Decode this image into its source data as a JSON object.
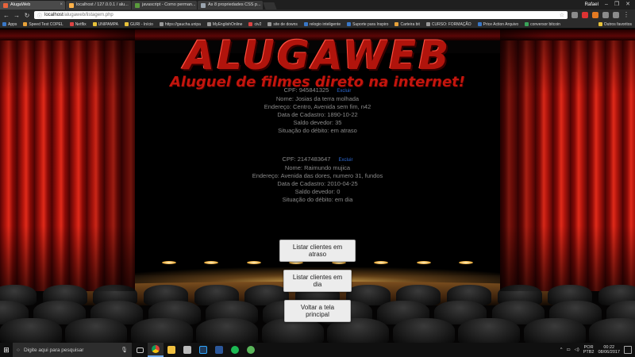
{
  "browser": {
    "tabs": [
      {
        "title": "AlugaWeb",
        "active": true,
        "favicon_color": "#e8643c"
      },
      {
        "title": "localhost / 127.0.0.1 / alu...",
        "active": false,
        "favicon_color": "#e8643c"
      },
      {
        "title": "javascript - Como perman...",
        "active": false,
        "favicon_color": "#5a9b3c"
      },
      {
        "title": "As 8 propriedades CSS p...",
        "active": false,
        "favicon_color": "#9aa4ae"
      }
    ],
    "user_name": "Rafael",
    "address_host": "localhost",
    "address_path": "/alugaweb/listagem.php",
    "bookmarks": [
      "Apps",
      "Speed Test COPEL",
      "Netflix",
      "UNIPAMPA",
      "GURI - Início",
      "https://gaucha.unipa",
      "MyEnglishOnline",
      "civ2",
      "site de downs",
      "relogio inteligente",
      "Suporte para Inspiro",
      "Carteira bit",
      "CURSO: FORMAÇÃO",
      "Price Action Arquivo",
      "conversor bitcoin"
    ],
    "other_bookmarks": "Outros favoritos"
  },
  "site": {
    "logo": "ALUGAWEB",
    "tagline": "Aluguel de filmes direto na internet!"
  },
  "labels": {
    "cpf": "CPF:",
    "name": "Nome:",
    "address": "Endereço:",
    "registered": "Data de Cadastro:",
    "balance": "Saldo devedor:",
    "debt_status": "Situação do débito:",
    "delete": "Excluir"
  },
  "clients": [
    {
      "cpf": "945841325",
      "name": "Josias da terra molhada",
      "address": "Centro, Avenida sem fim, n42",
      "registered": "1890-10-22",
      "balance": "35",
      "debt_status": "em atraso"
    },
    {
      "cpf": "2147483647",
      "name": "Raimundo mujica",
      "address": "Avenida das dores, numero 31, fundos",
      "registered": "2010-04-25",
      "balance": "0",
      "debt_status": "em dia"
    }
  ],
  "actions": {
    "overdue": "Listar clientes em atraso",
    "current": "Listar clientes em dia",
    "home": "Voltar a tela principal"
  },
  "taskbar": {
    "search_placeholder": "Digite aqui para pesquisar",
    "lang": "POR",
    "layout": "PTB2",
    "time": "00:22",
    "date": "08/06/2017"
  },
  "colors": {
    "curtain_red": "#b3160d",
    "logo_red": "#b1140c",
    "link_blue": "#2e6bd6",
    "text_gray": "#8a8a8a"
  }
}
